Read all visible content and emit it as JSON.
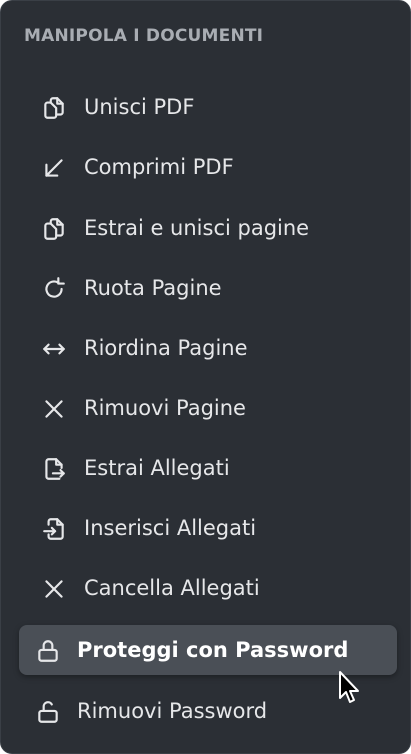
{
  "menu": {
    "section_title": "MANIPOLA I DOCUMENTI",
    "items": [
      {
        "label": "Unisci PDF",
        "icon": "merge-pages-icon"
      },
      {
        "label": "Comprimi PDF",
        "icon": "arrow-down-left-icon"
      },
      {
        "label": "Estrai e unisci pagine",
        "icon": "copy-pages-icon"
      },
      {
        "label": "Ruota Pagine",
        "icon": "rotate-icon"
      },
      {
        "label": "Riordina Pagine",
        "icon": "arrows-horizontal-icon"
      },
      {
        "label": "Rimuovi Pagine",
        "icon": "close-icon"
      },
      {
        "label": "Estrai Allegati",
        "icon": "file-export-icon"
      },
      {
        "label": "Inserisci Allegati",
        "icon": "file-import-icon"
      },
      {
        "label": "Cancella Allegati",
        "icon": "close-icon"
      },
      {
        "label": "Proteggi con Password",
        "icon": "lock-icon",
        "state": "hovered"
      },
      {
        "label": "Rimuovi Password",
        "icon": "unlock-icon"
      }
    ]
  },
  "colors": {
    "panel_background": "#2b2f35",
    "hover_background": "#4a4f56",
    "section_title": "#a9adb3",
    "text": "#e6e7e9"
  }
}
